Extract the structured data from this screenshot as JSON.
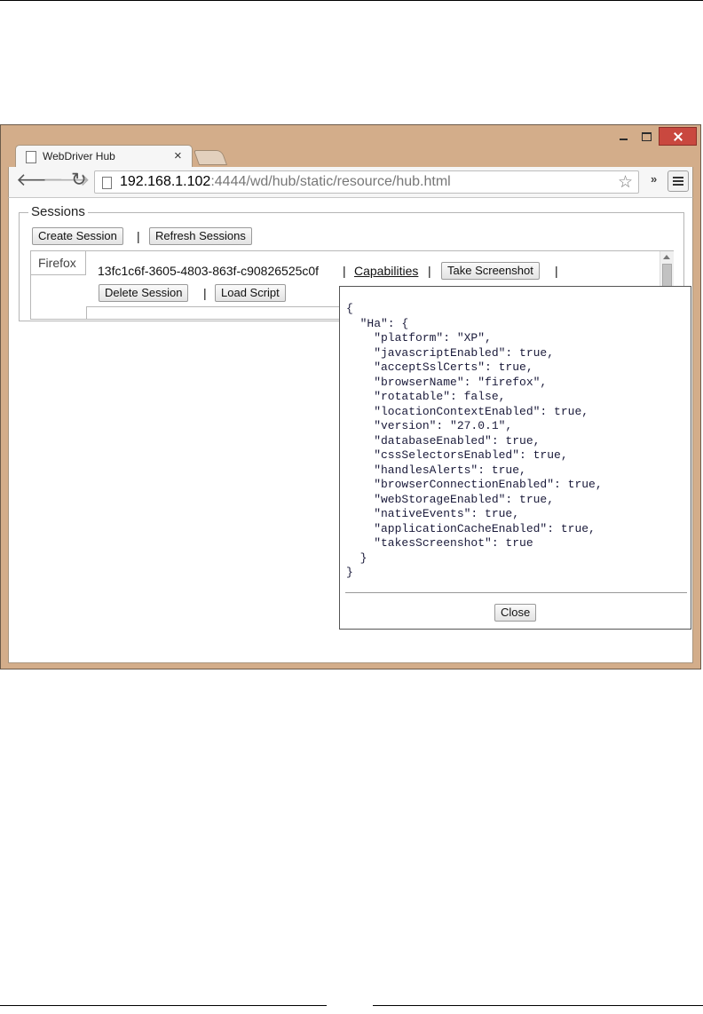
{
  "browser": {
    "tab_title": "WebDriver Hub",
    "tab_close": "×",
    "url_host": "192.168.1.102",
    "url_rest": ":4444/wd/hub/static/resource/hub.html",
    "overflow": "»",
    "icons": [
      "back-arrow-icon",
      "forward-arrow-icon",
      "reload-icon",
      "page-icon",
      "star-icon",
      "menu-icon"
    ]
  },
  "sessions": {
    "legend": "Sessions",
    "create_label": "Create Session",
    "refresh_label": "Refresh Sessions",
    "separator": "|",
    "browser_tab": "Firefox",
    "session_id": "13fc1c6f-3605-4803-863f-c90826525c0f",
    "capabilities_link": "Capabilities",
    "screenshot_label": "Take Screenshot",
    "delete_label": "Delete Session",
    "load_script_label": "Load Script"
  },
  "dialog": {
    "json_text": "{\n  \"Ha\": {\n    \"platform\": \"XP\",\n    \"javascriptEnabled\": true,\n    \"acceptSslCerts\": true,\n    \"browserName\": \"firefox\",\n    \"rotatable\": false,\n    \"locationContextEnabled\": true,\n    \"version\": \"27.0.1\",\n    \"databaseEnabled\": true,\n    \"cssSelectorsEnabled\": true,\n    \"handlesAlerts\": true,\n    \"browserConnectionEnabled\": true,\n    \"webStorageEnabled\": true,\n    \"nativeEvents\": true,\n    \"applicationCacheEnabled\": true,\n    \"takesScreenshot\": true\n  }\n}",
    "close_label": "Close"
  }
}
